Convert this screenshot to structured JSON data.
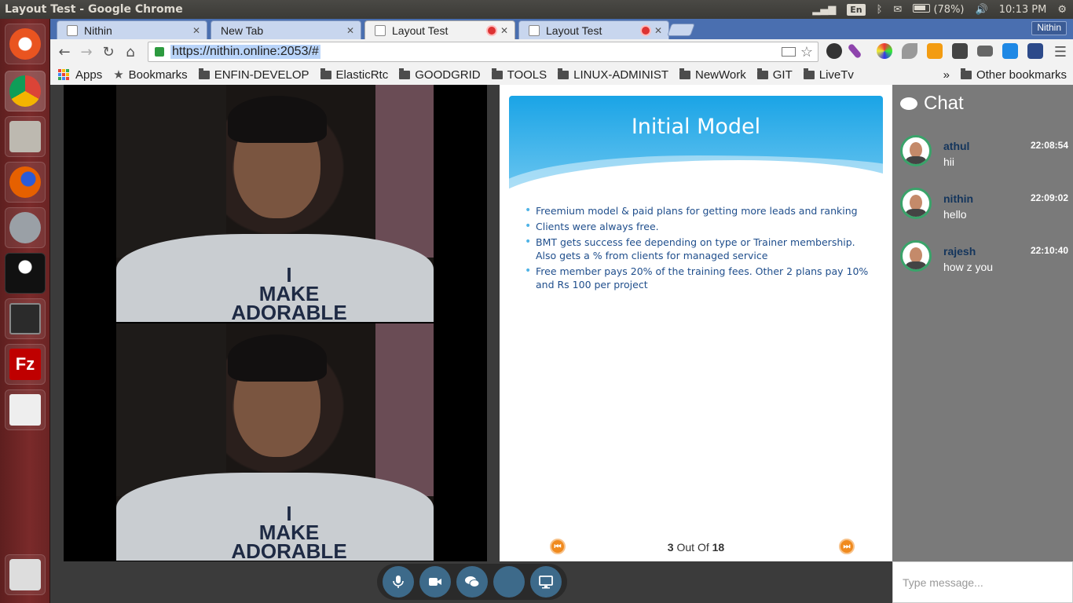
{
  "window": {
    "title": "Layout Test - Google Chrome",
    "indicators": {
      "keyboard": "En",
      "battery": "(78%)",
      "time": "10:13 PM"
    }
  },
  "tabs": [
    {
      "label": "Nithin",
      "active": false
    },
    {
      "label": "New Tab",
      "active": false
    },
    {
      "label": "Layout Test",
      "active": true
    },
    {
      "label": "Layout Test",
      "active": false
    }
  ],
  "profile": "Nithin",
  "omnibox": {
    "url": "https://nithin.online:2053/#"
  },
  "bookmarks": {
    "apps": "Apps",
    "items": [
      "Bookmarks",
      "ENFIN-DEVELOP",
      "ElasticRtc",
      "GOODGRID",
      "TOOLS",
      "LINUX-ADMINIST",
      "NewWork",
      "GIT",
      "LiveTv"
    ],
    "overflow": "»",
    "other": "Other bookmarks"
  },
  "videos": [
    {
      "tee_line1": "I",
      "tee_line2": "MAKE",
      "tee_line3": "ADORABLE"
    },
    {
      "tee_line1": "I",
      "tee_line2": "MAKE",
      "tee_line3": "ADORABLE"
    }
  ],
  "slide": {
    "title": "Initial Model",
    "bullets": [
      "Freemium model & paid plans for getting more leads and ranking",
      "Clients were always free.",
      "BMT gets success fee depending on type or Trainer membership. Also gets a % from clients for managed service",
      "Free member pays 20% of the training fees.  Other 2 plans pay 10% and Rs 100 per project"
    ],
    "current": "3",
    "out_of": "Out Of",
    "total": "18"
  },
  "chat": {
    "title": "Chat",
    "messages": [
      {
        "name": "athul",
        "time": "22:08:54",
        "text": "hii"
      },
      {
        "name": "nithin",
        "time": "22:09:02",
        "text": "hello"
      },
      {
        "name": "rajesh",
        "time": "22:10:40",
        "text": "how z you"
      }
    ],
    "input_placeholder": "Type message..."
  },
  "controls": [
    "microphone-icon",
    "video-camera-icon",
    "chat-icon",
    "blank",
    "screen-share-icon"
  ]
}
